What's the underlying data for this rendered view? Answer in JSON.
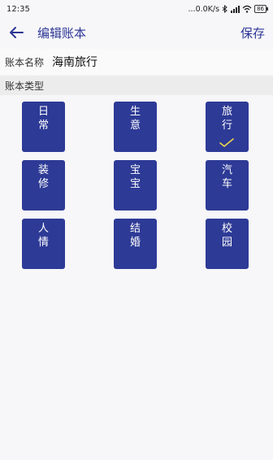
{
  "status_bar": {
    "time": "12:35",
    "speed": "...0.0K/s",
    "battery": "86"
  },
  "header": {
    "title": "编辑账本",
    "save_label": "保存"
  },
  "book_name": {
    "label": "账本名称",
    "value": "海南旅行"
  },
  "book_type": {
    "label": "账本类型",
    "items": [
      {
        "chars": [
          "日",
          "常"
        ],
        "selected": false
      },
      {
        "chars": [
          "生",
          "意"
        ],
        "selected": false
      },
      {
        "chars": [
          "旅",
          "行"
        ],
        "selected": true
      },
      {
        "chars": [
          "装",
          "修"
        ],
        "selected": false
      },
      {
        "chars": [
          "宝",
          "宝"
        ],
        "selected": false
      },
      {
        "chars": [
          "汽",
          "车"
        ],
        "selected": false
      },
      {
        "chars": [
          "人",
          "情"
        ],
        "selected": false
      },
      {
        "chars": [
          "结",
          "婚"
        ],
        "selected": false
      },
      {
        "chars": [
          "校",
          "园"
        ],
        "selected": false
      }
    ]
  },
  "colors": {
    "accent": "#2d3696",
    "tile": "#2d3a96",
    "check": "#f0d84a"
  }
}
